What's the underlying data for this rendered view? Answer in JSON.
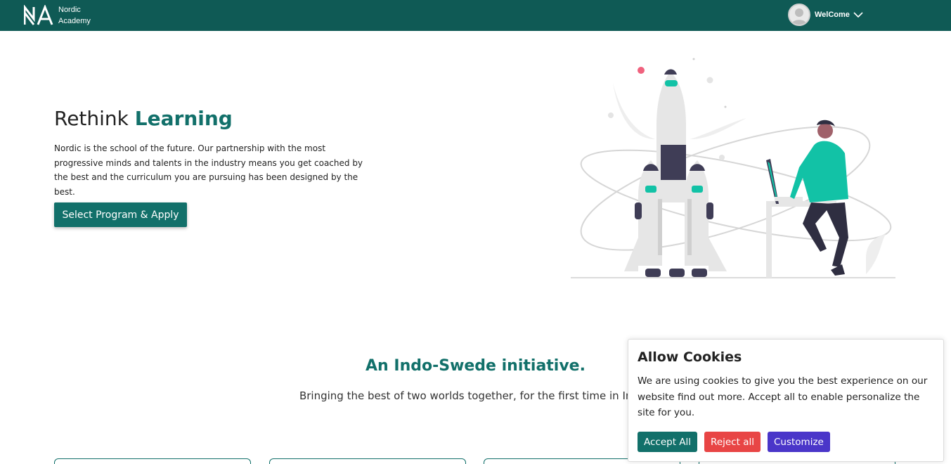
{
  "nav": {
    "brand_line1": "Nordic",
    "brand_line2": "Academy",
    "user_label": "WelCome",
    "icons": {
      "logo": "na-logo-icon",
      "avatar": "user-avatar-icon",
      "dropdown": "chevron-down-icon"
    }
  },
  "hero": {
    "title_plain": "Rethink",
    "title_accent": "Learning",
    "description": "Nordic is the school of the future. Our partnership with the most progressive minds and talents in the industry means you get coached by the best and the curriculum you are pursuing has been designed by the best.",
    "cta_label": "Select Program & Apply"
  },
  "section": {
    "title": "An Indo-Swede initiative.",
    "subtitle": "Bringing the best of two worlds together, for the first time in India."
  },
  "cookie": {
    "title": "Allow Cookies",
    "text": "We are using cookies to give you the best experience on our website find out more. Accept all to enable personalize the site for you.",
    "accept_label": "Accept All",
    "reject_label": "Reject all",
    "customize_label": "Customize"
  },
  "colors": {
    "primary": "#0f5a55",
    "accent": "#12706a",
    "teal_highlight": "#12c2a6",
    "reject": "#e84545",
    "customize": "#4a36c9"
  }
}
